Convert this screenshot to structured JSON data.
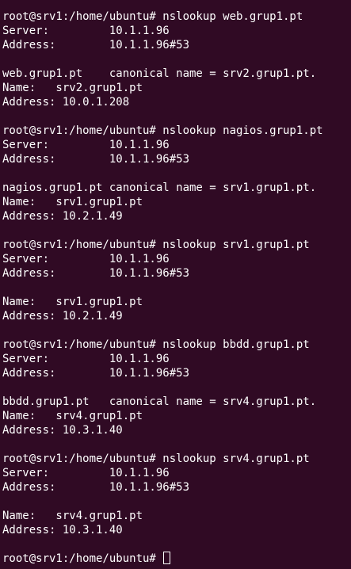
{
  "terminal": {
    "lines": [
      "root@srv1:/home/ubuntu# nslookup web.grup1.pt",
      "Server:         10.1.1.96",
      "Address:        10.1.1.96#53",
      "",
      "web.grup1.pt    canonical name = srv2.grup1.pt.",
      "Name:   srv2.grup1.pt",
      "Address: 10.0.1.208",
      "",
      "root@srv1:/home/ubuntu# nslookup nagios.grup1.pt",
      "Server:         10.1.1.96",
      "Address:        10.1.1.96#53",
      "",
      "nagios.grup1.pt canonical name = srv1.grup1.pt.",
      "Name:   srv1.grup1.pt",
      "Address: 10.2.1.49",
      "",
      "root@srv1:/home/ubuntu# nslookup srv1.grup1.pt",
      "Server:         10.1.1.96",
      "Address:        10.1.1.96#53",
      "",
      "Name:   srv1.grup1.pt",
      "Address: 10.2.1.49",
      "",
      "root@srv1:/home/ubuntu# nslookup bbdd.grup1.pt",
      "Server:         10.1.1.96",
      "Address:        10.1.1.96#53",
      "",
      "bbdd.grup1.pt   canonical name = srv4.grup1.pt.",
      "Name:   srv4.grup1.pt",
      "Address: 10.3.1.40",
      "",
      "root@srv1:/home/ubuntu# nslookup srv4.grup1.pt",
      "Server:         10.1.1.96",
      "Address:        10.1.1.96#53",
      "",
      "Name:   srv4.grup1.pt",
      "Address: 10.3.1.40",
      "",
      "root@srv1:/home/ubuntu# "
    ],
    "colors": {
      "background": "#300a24",
      "foreground": "#ffffff"
    }
  }
}
